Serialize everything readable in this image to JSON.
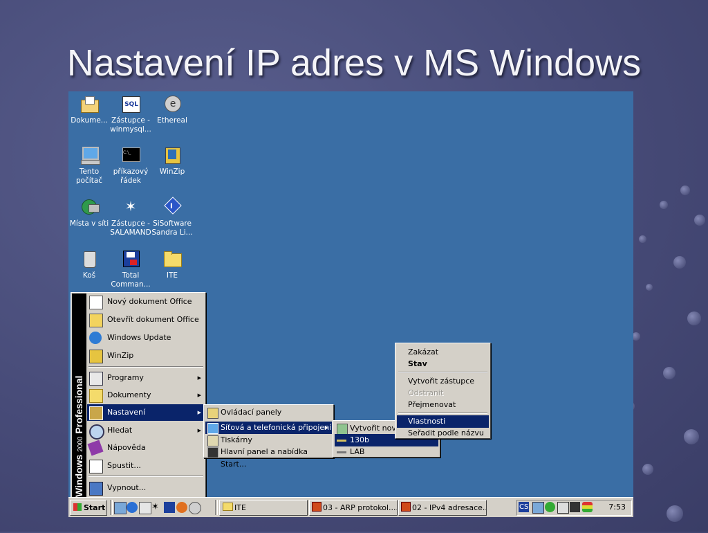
{
  "slide": {
    "title": "Nastavení IP adres v MS Windows"
  },
  "desktop": {
    "icons": [
      {
        "label": "Dokume...",
        "icon": "my-documents-icon"
      },
      {
        "label": "Zástupce - winmysql...",
        "icon": "sql-shortcut-icon"
      },
      {
        "label": "Ethereal",
        "icon": "ethereal-icon"
      },
      {
        "label": "Tento počítač",
        "icon": "my-computer-icon"
      },
      {
        "label": "příkazový řádek",
        "icon": "command-prompt-icon"
      },
      {
        "label": "WinZip",
        "icon": "winzip-icon"
      },
      {
        "label": "Místa v síti",
        "icon": "network-places-icon"
      },
      {
        "label": "Zástupce - SALAMAND",
        "icon": "salamander-icon"
      },
      {
        "label": "SiSoftware Sandra Li...",
        "icon": "sandra-icon"
      },
      {
        "label": "Koš",
        "icon": "recycle-bin-icon"
      },
      {
        "label": "Total Comman...",
        "icon": "total-commander-icon"
      },
      {
        "label": "ITE",
        "icon": "folder-icon"
      }
    ]
  },
  "start_menu": {
    "banner_bold": "Windows",
    "banner_light": "2000",
    "banner_bold2": "Professional",
    "items": [
      {
        "label": "Nový dokument Office"
      },
      {
        "label": "Otevřít dokument Office"
      },
      {
        "label": "Windows Update"
      },
      {
        "label": "WinZip"
      },
      {
        "label": "Programy"
      },
      {
        "label": "Dokumenty"
      },
      {
        "label": "Nastavení"
      },
      {
        "label": "Hledat"
      },
      {
        "label": "Nápověda"
      },
      {
        "label": "Spustit..."
      },
      {
        "label": "Vypnout..."
      }
    ]
  },
  "settings_menu": {
    "items": [
      {
        "label": "Ovládací panely"
      },
      {
        "label": "Síťová a telefonická připojení"
      },
      {
        "label": "Tiskárny"
      },
      {
        "label": "Hlavní panel a nabídka Start..."
      }
    ]
  },
  "network_menu": {
    "items": [
      {
        "label": "Vytvořit nové"
      },
      {
        "label": "130b"
      },
      {
        "label": "LAB"
      }
    ]
  },
  "context_menu": {
    "items": [
      {
        "label": "Zakázat"
      },
      {
        "label": "Stav"
      },
      {
        "label": "Vytvořit zástupce"
      },
      {
        "label": "Odstranit"
      },
      {
        "label": "Přejmenovat"
      },
      {
        "label": "Vlastnosti"
      },
      {
        "label": "Seřadit podle názvu"
      }
    ]
  },
  "taskbar": {
    "start_label": "Start",
    "tasks": [
      {
        "label": "ITE"
      },
      {
        "label": "03 - ARP protokol...."
      },
      {
        "label": "02 - IPv4 adresace...."
      }
    ],
    "lang": "CS",
    "clock": "7:53"
  },
  "colors": {
    "desktop": "#3a6ea5",
    "highlight": "#0a246a",
    "menu_face": "#d4d0c8"
  }
}
